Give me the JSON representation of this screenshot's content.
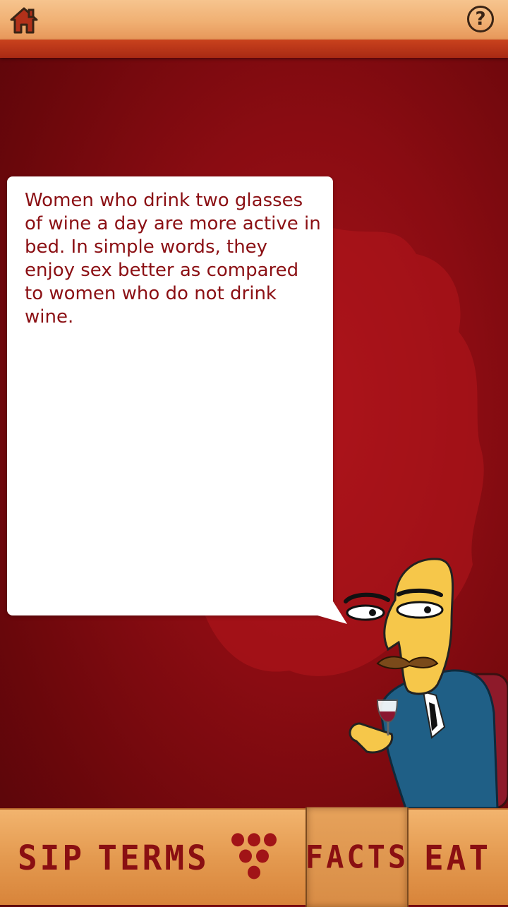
{
  "topbar": {
    "home_icon": "home-icon",
    "help_icon": "help-icon",
    "help_glyph": "?"
  },
  "fact": {
    "text": "Women who drink two glasses of wine a day are more active in bed. In simple words, they enjoy sex better as compared to women who do not drink wine."
  },
  "tabs": [
    {
      "label": "SIP",
      "selected": false
    },
    {
      "label": "TERMS",
      "selected": false
    },
    {
      "label": "",
      "icon": "grapes-icon",
      "selected": false
    },
    {
      "label": "FACTS",
      "selected": true
    },
    {
      "label": "EAT",
      "selected": false
    }
  ],
  "colors": {
    "text": "#8b1014",
    "background": "#8a0c12",
    "tab_text": "#8a0f12"
  }
}
